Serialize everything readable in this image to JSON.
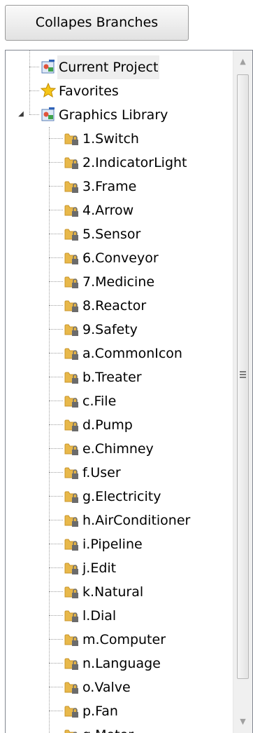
{
  "toolbar": {
    "collapse_label": "Collapes Branches"
  },
  "tree": {
    "roots": [
      {
        "label": "Current Project",
        "icon": "project-icon",
        "selected": true
      },
      {
        "label": "Favorites",
        "icon": "star-icon",
        "selected": false
      },
      {
        "label": "Graphics Library",
        "icon": "project-icon",
        "selected": false,
        "expanded": true
      }
    ],
    "children": [
      "1.Switch",
      "2.IndicatorLight",
      "3.Frame",
      "4.Arrow",
      "5.Sensor",
      "6.Conveyor",
      "7.Medicine",
      "8.Reactor",
      "9.Safety",
      "a.CommonIcon",
      "b.Treater",
      "c.File",
      "d.Pump",
      "e.Chimney",
      "f.User",
      "g.Electricity",
      "h.AirConditioner",
      "i.Pipeline",
      "j.Edit",
      "k.Natural",
      "l.Dial",
      "m.Computer",
      "n.Language",
      "o.Valve",
      "p.Fan",
      "q.Motor"
    ],
    "child_icon": "locked-folder-icon"
  },
  "colors": {
    "folder": "#e8b84a",
    "lock": "#6b6b6b",
    "star": "#f5c518",
    "selection": "#eeeeee"
  }
}
